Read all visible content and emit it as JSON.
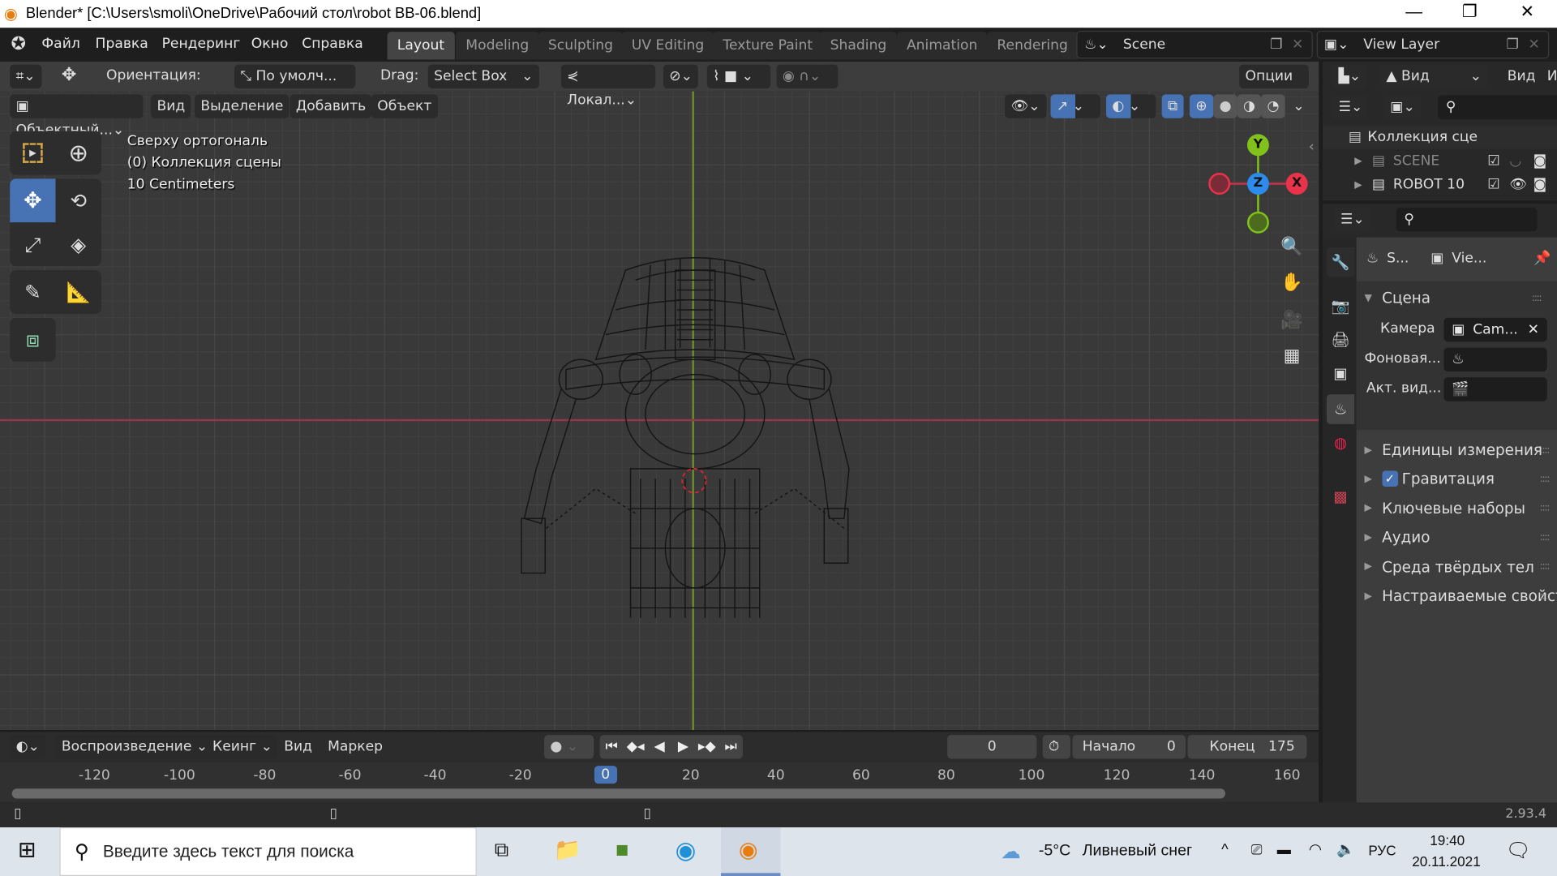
{
  "window": {
    "title": "Blender* [C:\\Users\\smoli\\OneDrive\\Рабочий стол\\robot BB-06.blend]",
    "minimize": "—",
    "restore": "❐",
    "close": "✕"
  },
  "menu": [
    "Файл",
    "Правка",
    "Рендеринг",
    "Окно",
    "Справка"
  ],
  "workspaces": [
    "Layout",
    "Modeling",
    "Sculpting",
    "UV Editing",
    "Texture Paint",
    "Shading",
    "Animation",
    "Rendering"
  ],
  "active_workspace": "Layout",
  "scene": {
    "name": "Scene",
    "view_layer": "View Layer"
  },
  "tool_settings": {
    "orientation_label": "Ориентация:",
    "orientation_value": "По умолч...",
    "drag_label": "Drag:",
    "drag_value": "Select Box",
    "pivot_value": "Локал...",
    "options": "Опции"
  },
  "viewport_header": {
    "mode": "Объектный...",
    "menus": [
      "Вид",
      "Выделение",
      "Добавить",
      "Объект"
    ]
  },
  "overlay": {
    "view_name": "Сверху ортогональ",
    "collection": "(0) Коллекция сцены",
    "scale": "10 Centimeters"
  },
  "gizmo": {
    "y": "Y",
    "z": "Z",
    "x": "X"
  },
  "outliner": {
    "header_view": "Вид",
    "header_menu1": "Вид",
    "header_menu2": "Изоб",
    "root": "Коллекция сце",
    "items": [
      {
        "name": "SCENE",
        "visible": false
      },
      {
        "name": "ROBOT 10",
        "visible": true
      }
    ]
  },
  "properties": {
    "breadcrumb_scene": "S...",
    "breadcrumb_view": "Vie...",
    "panel": "Сцена",
    "camera_label": "Камера",
    "camera_value": "Cam...",
    "bg_label": "Фоновая...",
    "clip_label": "Акт. вид...",
    "subpanels": [
      {
        "label": "Единицы измерения"
      },
      {
        "label": "Гравитация",
        "checkbox": true
      },
      {
        "label": "Ключевые наборы"
      },
      {
        "label": "Аудио"
      },
      {
        "label": "Среда твёрдых тел"
      },
      {
        "label": "Настраиваемые свойст"
      }
    ]
  },
  "timeline": {
    "menus": [
      "Воспроизведение",
      "Кеинг",
      "Вид",
      "Маркер"
    ],
    "current_frame": "0",
    "start_label": "Начало",
    "start": "0",
    "end_label": "Конец",
    "end": "175",
    "ticks": [
      "-120",
      "-100",
      "-80",
      "-60",
      "-40",
      "-20",
      "0",
      "20",
      "40",
      "60",
      "80",
      "100",
      "120",
      "140",
      "160"
    ]
  },
  "status": {
    "version": "2.93.4"
  },
  "taskbar": {
    "search_placeholder": "Введите здесь текст для поиска",
    "weather_temp": "-5°C",
    "weather_text": "Ливневый снег",
    "lang": "РУС",
    "time": "19:40",
    "date": "20.11.2021"
  },
  "colors": {
    "accent": "#4772b3",
    "x_axis": "#e8334a",
    "y_axis": "#80c21b",
    "z_axis": "#2d8ceb"
  }
}
